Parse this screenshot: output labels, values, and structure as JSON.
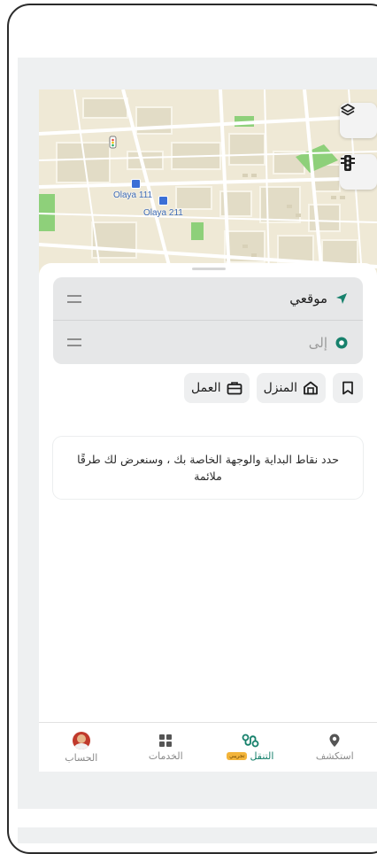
{
  "map": {
    "labels": [
      "Olaya 111",
      "Olaya 211"
    ],
    "buttons": {
      "layers_icon": "layers-icon",
      "traffic_icon": "traffic-light-icon"
    }
  },
  "route": {
    "from_label": "موقعي",
    "to_label": "إلى"
  },
  "shortcuts": {
    "home_label": "المنزل",
    "work_label": "العمل"
  },
  "hint_text": "حدد نقاط البداية والوجهة الخاصة بك ، وسنعرض لك طرقًا ملائمة",
  "tabbar": {
    "items": [
      {
        "label": "استكشف",
        "icon": "location-pin-icon",
        "active": false
      },
      {
        "label": "التنقل",
        "icon": "route-icon",
        "active": true,
        "badge": "تجريبي"
      },
      {
        "label": "الخدمات",
        "icon": "grid-icon",
        "active": false
      },
      {
        "label": "الحساب",
        "icon": "avatar",
        "active": false
      }
    ]
  },
  "colors": {
    "accent": "#17816c",
    "map_bg": "#efe9d6",
    "map_green": "#8ed07a"
  }
}
